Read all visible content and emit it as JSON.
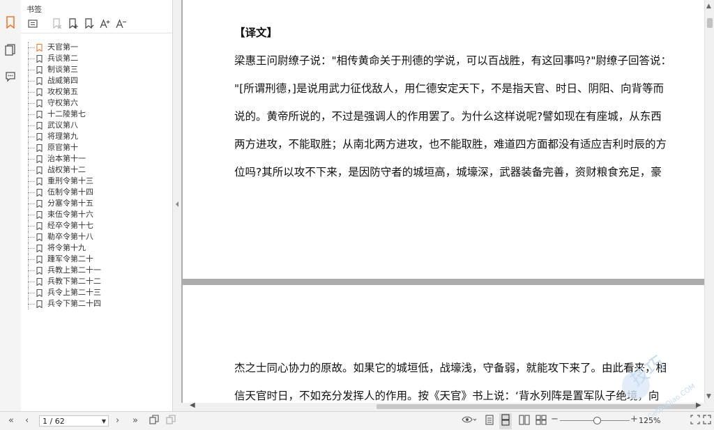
{
  "sidebar": {
    "title": "书签",
    "bookmarks": [
      "天官第一",
      "兵谈第二",
      "制谈第三",
      "战威第四",
      "攻权第五",
      "守权第六",
      "十二陵第七",
      "武议第八",
      "将理第九",
      "原官第十",
      "治本第十一",
      "战权第十二",
      "重刑令第十三",
      "伍制令第十四",
      "分塞令第十五",
      "束伍令第十六",
      "经卒令第十七",
      "勒卒令第十八",
      "将令第十九",
      "踵军令第二十",
      "兵教上第二十一",
      "兵教下第二十二",
      "兵令上第二十三",
      "兵令下第二十四"
    ]
  },
  "document": {
    "heading": "【译文】",
    "page1_lines": [
      "梁惠王问尉缭子说：\"相传黄命关于刑德的学说，可以百战胜，有这回事吗?\"尉缭子回答说：",
      "\"[所谓刑德，]是说用武力征伐敌人，用仁德安定天下，不是指天官、时日、阴阳、向背等而",
      "说的。黄帝所说的，不过是强调人的作用罢了。为什么这样说呢?譬如现在有座城，从东西",
      "两方进攻，不能取胜；从南北两方进攻，也不能取胜，难道四方面都没有适应吉利时辰的方",
      "位吗?其所以攻不下来，是因防守者的城垣高，城壕深，武器装备完善，资财粮食充足，豪"
    ],
    "page2_lines": [
      "杰之士同心协力的原故。如果它的城垣低，战壕浅，守备弱，就能攻下来了。由此看来，相",
      "信天官时日，不如充分发挥人的作用。按《天官》书上说：‘背水列阵是置军队子绝境，向"
    ]
  },
  "status": {
    "page_indicator": "1 / 62",
    "zoom": "125%"
  },
  "watermark": {
    "text": "技巧",
    "url_text": "GetBuQiao.COM"
  },
  "colors": {
    "bookmark_active": "#f07a30",
    "bookmark_icon": "#555555"
  }
}
